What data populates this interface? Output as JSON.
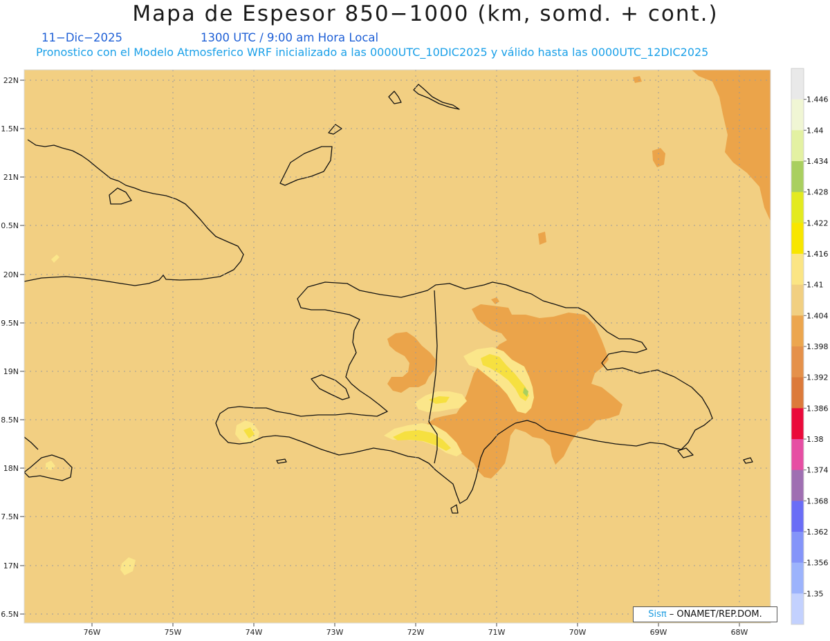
{
  "header": {
    "title": "Mapa de Espesor 850−1000 (km, somd. + cont.)",
    "date": "11−Dic−2025",
    "time": "1300 UTC / 9:00 am Hora Local",
    "model_line": "Pronostico con el Modelo Atmosferico WRF inicializado a las 0000UTC_10DIC2025 y válido hasta las  0000UTC_12DIC2025"
  },
  "map": {
    "lat_labels": [
      "22N",
      "1.5N",
      "21N",
      "0.5N",
      "20N",
      "9.5N",
      "19N",
      "8.5N",
      "18N",
      "7.5N",
      "17N",
      "6.5N"
    ],
    "lon_labels": [
      "76W",
      "75W",
      "74W",
      "73W",
      "72W",
      "71W",
      "70W",
      "69W",
      "68W"
    ],
    "colors": {
      "background": "#f2cf82",
      "thickness_1398": "#eba44a",
      "thickness_1410": "#fbe68a",
      "thickness_1416": "#f6e040",
      "coast": "#111111"
    }
  },
  "legend": {
    "labels": [
      "1.446",
      "1.44",
      "1.434",
      "1.428",
      "1.422",
      "1.416",
      "1.41",
      "1.404",
      "1.398",
      "1.392",
      "1.386",
      "1.38",
      "1.374",
      "1.368",
      "1.362",
      "1.356",
      "1.35"
    ],
    "colors": [
      "#e9e9e9",
      "#f0f6d4",
      "#e3f1a2",
      "#a9cf5f",
      "#e3ea20",
      "#f8e600",
      "#fbe584",
      "#f1cf81",
      "#eca64e",
      "#e5914a",
      "#dc7a3a",
      "#ea0a3a",
      "#e64ea3",
      "#9f6fb2",
      "#6a6df6",
      "#8494f9",
      "#9cb3fc",
      "#c3d1fe"
    ]
  },
  "footer": {
    "brand": "Sisπ",
    "credit": "– ONAMET/REP.DOM."
  }
}
